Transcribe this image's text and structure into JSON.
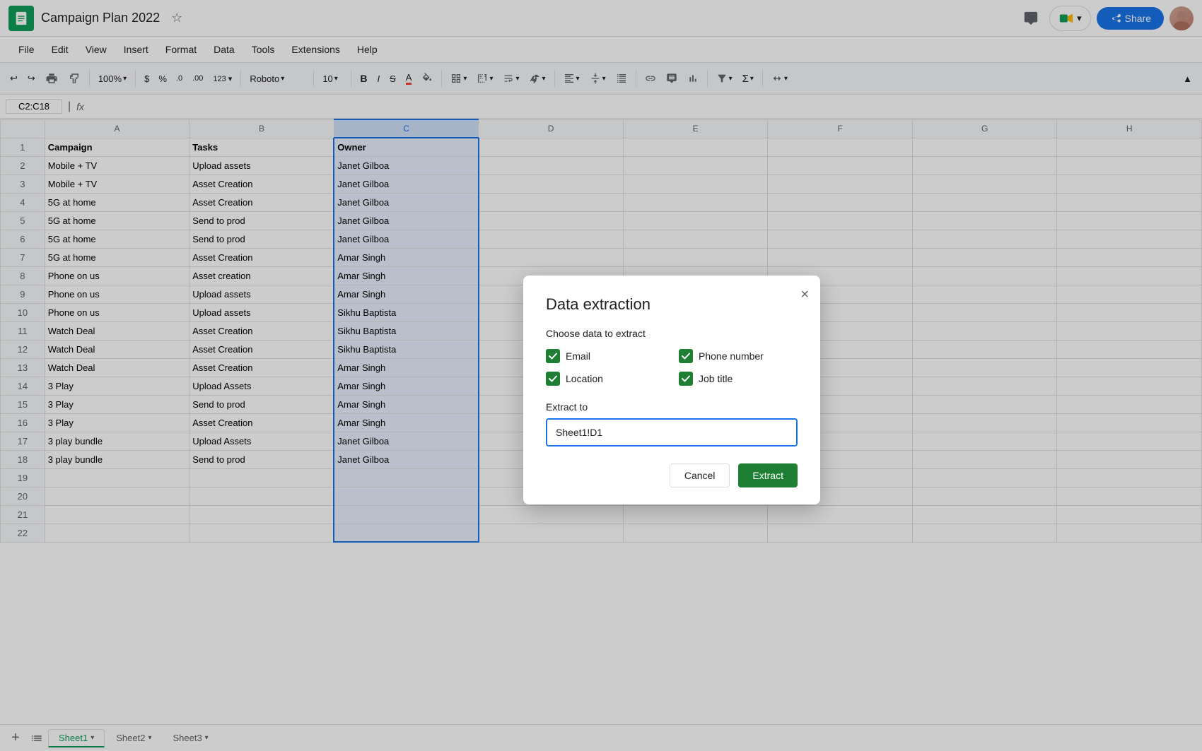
{
  "app": {
    "icon_color": "#0f9d58",
    "title": "Campaign Plan 2022",
    "starred": false
  },
  "header": {
    "menu_items": [
      "File",
      "Edit",
      "View",
      "Insert",
      "Format",
      "Data",
      "Tools",
      "Extensions",
      "Help"
    ],
    "share_label": "Share",
    "comment_icon": "💬",
    "meet_icon": "📹"
  },
  "toolbar": {
    "undo_icon": "↩",
    "redo_icon": "↪",
    "print_icon": "🖨",
    "format_icon": "🎨",
    "zoom": "100%",
    "currency_icon": "$",
    "percent_icon": "%",
    "decimal_decrease": ".0",
    "decimal_increase": ".00",
    "format_as": "123",
    "font": "Roboto",
    "font_size": "10",
    "bold": "B",
    "italic": "I",
    "strikethrough": "S̶",
    "font_color": "A",
    "fill_color": "🎨",
    "borders": "⊞",
    "merge": "⊟",
    "text_wrap": "↵",
    "text_rotation": "⟳",
    "h_align": "≡",
    "v_align": "⊥",
    "more_formats": "...",
    "insert_link": "🔗",
    "insert_comment": "💬",
    "insert_chart": "📊",
    "filter": "▽",
    "functions": "Σ",
    "hide_row_col": "↕",
    "collapse": "↑"
  },
  "formula_bar": {
    "cell_ref": "C2:C18",
    "fx_label": "fx"
  },
  "grid": {
    "col_headers": [
      "",
      "A",
      "B",
      "C",
      "D",
      "E",
      "F",
      "G",
      "H"
    ],
    "rows": [
      {
        "row": 1,
        "cells": [
          "Campaign",
          "Tasks",
          "Owner",
          "",
          "",
          "",
          "",
          ""
        ]
      },
      {
        "row": 2,
        "cells": [
          "Mobile + TV",
          "Upload assets",
          "Janet Gilboa",
          "",
          "",
          "",
          "",
          ""
        ]
      },
      {
        "row": 3,
        "cells": [
          "Mobile + TV",
          "Asset Creation",
          "Janet Gilboa",
          "",
          "",
          "",
          "",
          ""
        ]
      },
      {
        "row": 4,
        "cells": [
          "5G at home",
          "Asset Creation",
          "Janet Gilboa",
          "",
          "",
          "",
          "",
          ""
        ]
      },
      {
        "row": 5,
        "cells": [
          "5G at home",
          "Send to prod",
          "Janet Gilboa",
          "",
          "",
          "",
          "",
          ""
        ]
      },
      {
        "row": 6,
        "cells": [
          "5G at home",
          "Send to prod",
          "Janet Gilboa",
          "",
          "",
          "",
          "",
          ""
        ]
      },
      {
        "row": 7,
        "cells": [
          "5G at home",
          "Asset Creation",
          "Amar Singh",
          "",
          "",
          "",
          "",
          ""
        ]
      },
      {
        "row": 8,
        "cells": [
          "Phone on us",
          "Asset creation",
          "Amar Singh",
          "",
          "",
          "",
          "",
          ""
        ]
      },
      {
        "row": 9,
        "cells": [
          "Phone on us",
          "Upload assets",
          "Amar Singh",
          "",
          "",
          "",
          "",
          ""
        ]
      },
      {
        "row": 10,
        "cells": [
          "Phone on us",
          "Upload assets",
          "Sikhu Baptista",
          "",
          "",
          "",
          "",
          ""
        ]
      },
      {
        "row": 11,
        "cells": [
          "Watch Deal",
          "Asset Creation",
          "Sikhu Baptista",
          "",
          "",
          "",
          "",
          ""
        ]
      },
      {
        "row": 12,
        "cells": [
          "Watch Deal",
          "Asset Creation",
          "Sikhu Baptista",
          "",
          "",
          "",
          "",
          ""
        ]
      },
      {
        "row": 13,
        "cells": [
          "Watch Deal",
          "Asset Creation",
          "Amar Singh",
          "",
          "",
          "",
          "",
          ""
        ]
      },
      {
        "row": 14,
        "cells": [
          "3 Play",
          "Upload Assets",
          "Amar Singh",
          "",
          "",
          "",
          "",
          ""
        ]
      },
      {
        "row": 15,
        "cells": [
          "3 Play",
          "Send to prod",
          "Amar Singh",
          "",
          "",
          "",
          "",
          ""
        ]
      },
      {
        "row": 16,
        "cells": [
          "3 Play",
          "Asset Creation",
          "Amar Singh",
          "",
          "",
          "",
          "",
          ""
        ]
      },
      {
        "row": 17,
        "cells": [
          "3 play bundle",
          "Upload Assets",
          "Janet Gilboa",
          "",
          "",
          "",
          "",
          ""
        ]
      },
      {
        "row": 18,
        "cells": [
          "3 play bundle",
          "Send to prod",
          "Janet Gilboa",
          "",
          "",
          "",
          "",
          ""
        ]
      },
      {
        "row": 19,
        "cells": [
          "",
          "",
          "",
          "",
          "",
          "",
          "",
          ""
        ]
      },
      {
        "row": 20,
        "cells": [
          "",
          "",
          "",
          "",
          "",
          "",
          "",
          ""
        ]
      },
      {
        "row": 21,
        "cells": [
          "",
          "",
          "",
          "",
          "",
          "",
          "",
          ""
        ]
      },
      {
        "row": 22,
        "cells": [
          "",
          "",
          "",
          "",
          "",
          "",
          "",
          ""
        ]
      }
    ]
  },
  "dialog": {
    "title": "Data extraction",
    "section_label": "Choose data to extract",
    "checkboxes": [
      {
        "id": "email",
        "label": "Email",
        "checked": true
      },
      {
        "id": "phone",
        "label": "Phone number",
        "checked": true
      },
      {
        "id": "location",
        "label": "Location",
        "checked": true
      },
      {
        "id": "jobtitle",
        "label": "Job title",
        "checked": true
      }
    ],
    "extract_to_label": "Extract to",
    "extract_to_value": "Sheet1!D1",
    "cancel_label": "Cancel",
    "extract_label": "Extract",
    "close_icon": "×"
  },
  "bottom_bar": {
    "sheets": [
      {
        "name": "Sheet1",
        "active": true
      },
      {
        "name": "Sheet2",
        "active": false
      },
      {
        "name": "Sheet3",
        "active": false
      }
    ]
  }
}
